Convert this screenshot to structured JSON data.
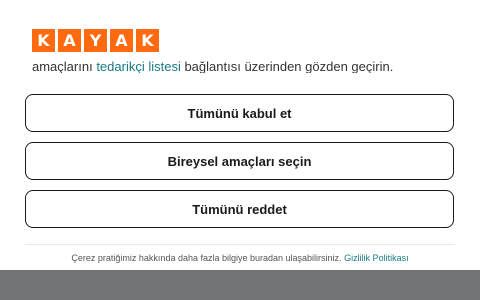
{
  "logo": {
    "letters": [
      "K",
      "A",
      "Y",
      "A",
      "K"
    ],
    "color": "#ff690f"
  },
  "intro": {
    "before": "amaçlarını ",
    "link": "tedarikçi listesi",
    "after": " bağlantısı üzerinden gözden geçirin."
  },
  "buttons": {
    "accept_all": "Tümünü kabul et",
    "select_individual": "Bireysel amaçları seçin",
    "reject_all": "Tümünü reddet"
  },
  "footer": {
    "text": "Çerez pratiğimiz hakkında daha fazla bilgiye buradan ulaşabilirsiniz. ",
    "link": "Gizlilik Politikası"
  },
  "colors": {
    "link": "#1b7a85",
    "backdrop": "#717576"
  }
}
